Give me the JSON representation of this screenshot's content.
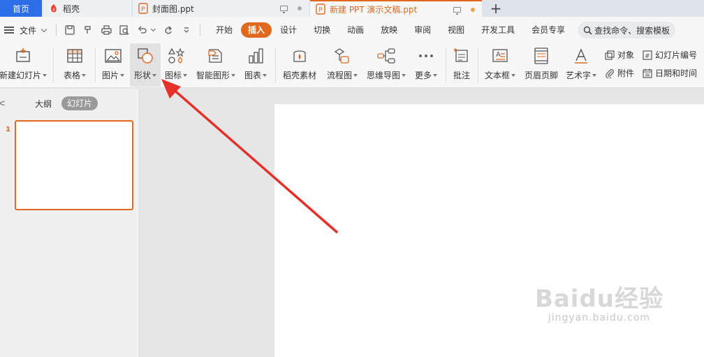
{
  "tabs": {
    "home": "首页",
    "docer": "稻壳",
    "doc1": "封面图.ppt",
    "doc2": "新建 PPT 演示文稿.ppt",
    "add": "+"
  },
  "menubar": {
    "file": "文件",
    "items": [
      "开始",
      "插入",
      "设计",
      "切换",
      "动画",
      "放映",
      "审阅",
      "视图",
      "开发工具",
      "会员专享"
    ],
    "active": "插入",
    "search": "查找命令、搜索模板"
  },
  "ribbon": {
    "new_slide": "新建幻灯片",
    "table": "表格",
    "picture": "图片",
    "shape": "形状",
    "icon": "图标",
    "smartart": "智能图形",
    "chart": "图表",
    "docer_material": "稻壳素材",
    "flowchart": "流程图",
    "mindmap": "思维导图",
    "more": "更多",
    "comment": "批注",
    "textbox": "文本框",
    "header_footer": "页眉页脚",
    "wordart": "艺术字",
    "object": "对象",
    "attachment": "附件",
    "slide_number": "幻灯片编号",
    "datetime": "日期和时间"
  },
  "leftpanel": {
    "close": "<",
    "outline": "大纲",
    "slides": "幻灯片",
    "slide_number": "1"
  },
  "watermark": {
    "line1": "Baidu经验",
    "line2": "jingyan.baidu.com"
  },
  "colors": {
    "accent": "#e0691f",
    "home_tab": "#2d6ee6",
    "arrow": "#e8302a"
  }
}
